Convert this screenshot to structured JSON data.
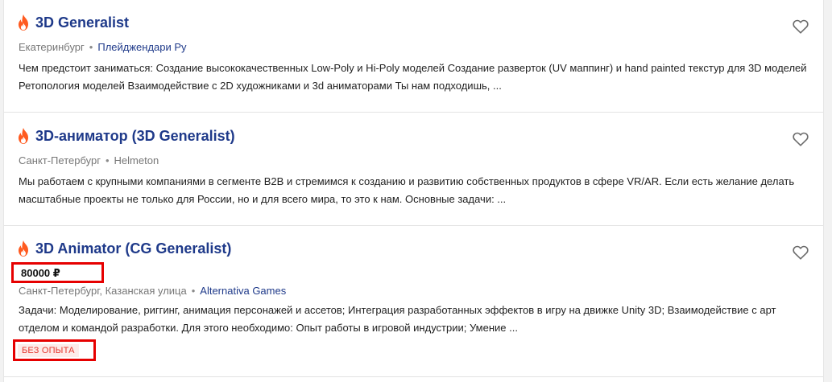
{
  "colors": {
    "title": "#1f3a8a",
    "fire": "#ff5a1f",
    "highlight_box": "#e60000",
    "badge_text": "#e5372e"
  },
  "vacancies": [
    {
      "title": "3D Generalist",
      "icon": "fire-icon",
      "city": "Екатеринбург",
      "company": "Плейджендари Ру",
      "description": "Чем предстоит заниматься: Создание высококачественных Low-Poly и Hi-Poly моделей Создание разверток (UV маппинг) и hand painted текстур для 3D моделей Ретопология моделей Взаимодействие с 2D художниками и 3d аниматорами Ты нам подходишь, ...",
      "favorite_icon": "heart-icon"
    },
    {
      "title": "3D-аниматор (3D Generalist)",
      "icon": "fire-icon",
      "city": "Санкт-Петербург",
      "company": "Helmeton",
      "description": "Мы работаем с крупными компаниями в сегменте B2B и стремимся к созданию и развитию собственных продуктов в сфере VR/AR. Если есть желание делать масштабные проекты не только для России, но и для всего мира, то это к нам. Основные задачи: ...",
      "favorite_icon": "heart-icon"
    },
    {
      "title": "3D Animator (CG Generalist)",
      "icon": "fire-icon",
      "salary": "80000 ₽",
      "city": "Санкт-Петербург, Казанская улица",
      "company": "Alternativa Games",
      "description": "Задачи: Моделирование, риггинг, анимация персонажей и ассетов; Интеграция разработанных эффектов в игру на движке Unity 3D; Взаимодействие с арт отделом и командой разработки. Для этого необходимо: Опыт работы в игровой индустрии; Умение ...",
      "badge": "БЕЗ ОПЫТА",
      "favorite_icon": "heart-icon"
    }
  ]
}
